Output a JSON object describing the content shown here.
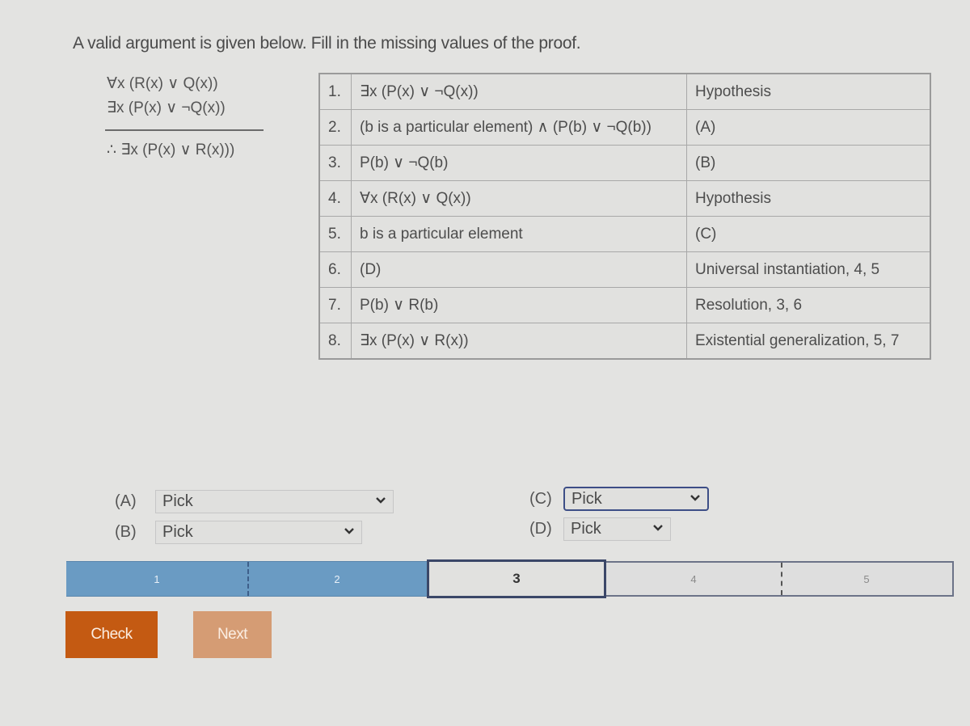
{
  "instructions": "A valid argument is given below. Fill in the missing values of the proof.",
  "argument": {
    "premises": [
      "∀x (R(x) ∨ Q(x))",
      "∃x (P(x) ∨ ¬Q(x))"
    ],
    "conclusion": "∴ ∃x (P(x) ∨ R(x)))"
  },
  "proof": [
    {
      "num": "1.",
      "statement": "∃x (P(x) ∨ ¬Q(x))",
      "reason": "Hypothesis"
    },
    {
      "num": "2.",
      "statement": "(b is a particular element) ∧ (P(b) ∨ ¬Q(b))",
      "reason": "(A)"
    },
    {
      "num": "3.",
      "statement": "P(b) ∨ ¬Q(b)",
      "reason": "(B)"
    },
    {
      "num": "4.",
      "statement": "∀x (R(x) ∨ Q(x))",
      "reason": "Hypothesis"
    },
    {
      "num": "5.",
      "statement": "b is a particular element",
      "reason": "(C)"
    },
    {
      "num": "6.",
      "statement": "(D)",
      "reason": "Universal instantiation, 4, 5"
    },
    {
      "num": "7.",
      "statement": "P(b) ∨ R(b)",
      "reason": "Resolution, 3, 6"
    },
    {
      "num": "8.",
      "statement": "∃x (P(x) ∨ R(x))",
      "reason": "Existential generalization, 5, 7"
    }
  ],
  "picks": [
    {
      "label": "(A)",
      "value": "Pick"
    },
    {
      "label": "(B)",
      "value": "Pick"
    },
    {
      "label": "(C)",
      "value": "Pick"
    },
    {
      "label": "(D)",
      "value": "Pick"
    }
  ],
  "progress": {
    "steps": [
      "1",
      "2",
      "3",
      "4",
      "5"
    ],
    "current": 3,
    "completed": 2,
    "colors": {
      "done": "#6a9bc3",
      "current_border": "#3b4768"
    }
  },
  "buttons": {
    "check": "Check",
    "next": "Next"
  },
  "colors": {
    "check": "#c45a12",
    "next": "#d59c74",
    "focus": "#3d4e86"
  }
}
